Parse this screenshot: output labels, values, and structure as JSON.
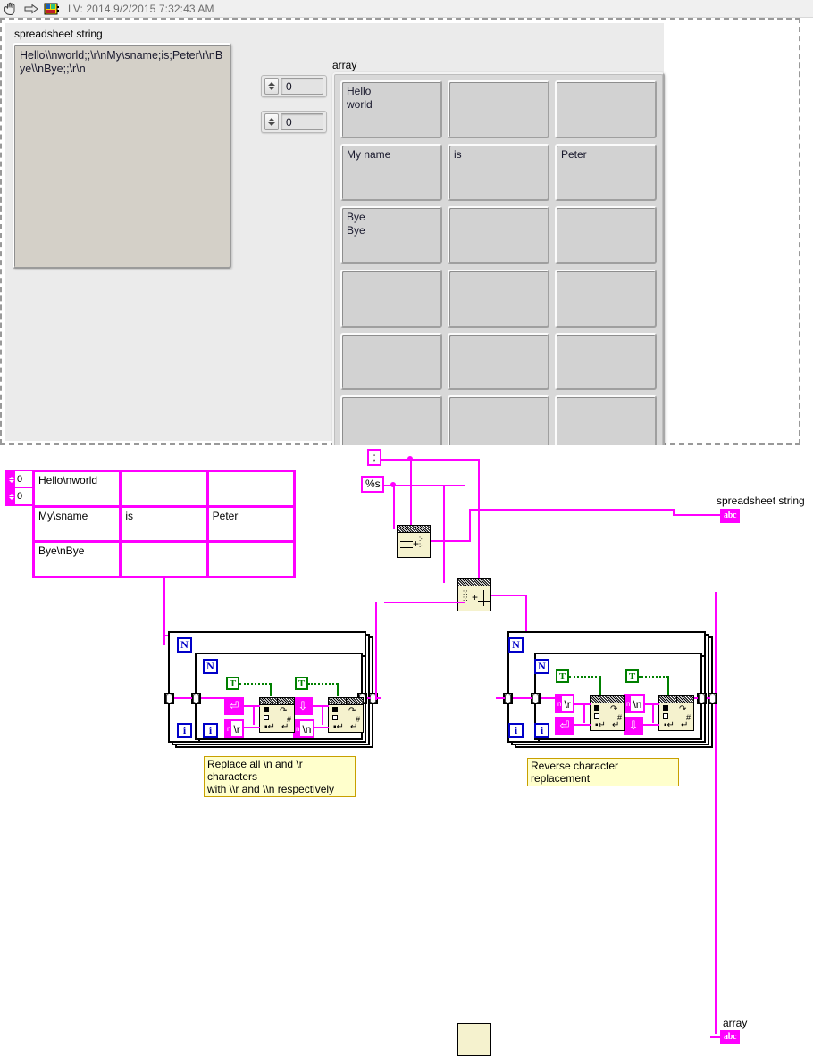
{
  "toolbar": {
    "icons": [
      "hand-cursor-icon",
      "run-arrow-icon",
      "labview-vi-icon"
    ],
    "title": "LV: 2014 9/2/2015 7:32:43 AM"
  },
  "front_panel": {
    "spreadsheet_string": {
      "label": "spreadsheet string",
      "value": "Hello\\\\nworld;;\\r\\nMy\\sname;is;Peter\\r\\nBye\\\\nBye;;\\r\\n"
    },
    "index_controls": [
      {
        "name": "row-index",
        "value": "0"
      },
      {
        "name": "column-index",
        "value": "0"
      }
    ],
    "array": {
      "label": "array",
      "rows": 6,
      "cols": 3,
      "cells": [
        "Hello\nworld",
        "",
        "",
        "My name",
        "is",
        "Peter",
        "Bye\nBye",
        "",
        "",
        "",
        "",
        "",
        "",
        "",
        "",
        "",
        "",
        ""
      ]
    }
  },
  "block_diagram": {
    "array_constant": {
      "index_values": [
        "0",
        "0"
      ],
      "cells": [
        "Hello\\nworld",
        "",
        "",
        "My\\sname",
        "is",
        "Peter",
        "Bye\\nBye",
        "",
        ""
      ]
    },
    "string_constants": {
      "delimiter": ";",
      "format": "%s"
    },
    "nodes": [
      {
        "name": "array-to-spreadsheet-string-node"
      },
      {
        "name": "spreadsheet-string-to-array-node"
      }
    ],
    "indicators": [
      {
        "name": "spreadsheet-string-indicator",
        "label": "spreadsheet string",
        "terminal": "abc"
      },
      {
        "name": "array-indicator",
        "label": "array",
        "terminal": "abc"
      }
    ],
    "loop_left": {
      "outer_count": "N",
      "inner_count": "N",
      "outer_iter": "i",
      "inner_iter": "i",
      "bool_constants": [
        "T",
        "T"
      ],
      "escape_constants": [
        "carriage-return-glyph",
        "line-feed-glyph"
      ],
      "string_constants": [
        "\\r",
        "\\n"
      ],
      "comment": "Replace all \\n and \\r characters\nwith \\\\r and \\\\n respectively"
    },
    "loop_right": {
      "outer_count": "N",
      "inner_count": "N",
      "outer_iter": "i",
      "inner_iter": "i",
      "bool_constants": [
        "T",
        "T"
      ],
      "escape_constants": [
        "carriage-return-glyph",
        "line-feed-glyph"
      ],
      "string_constants": [
        "\\r",
        "\\n"
      ],
      "comment": "Reverse character replacement"
    }
  },
  "colors": {
    "wire_magenta": "#FF00FF",
    "node_yellow": "#F5F2CE",
    "comment_yellow": "#FFFFCC",
    "bool_green": "#008000",
    "loop_blue": "#0000C8",
    "panel_gray": "#EBEBEB"
  }
}
